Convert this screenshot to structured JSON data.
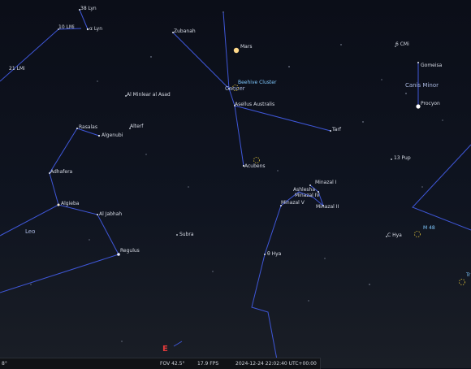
{
  "compass": {
    "east": "E"
  },
  "status": {
    "left_value": "8°",
    "fov": "FOV 42.5°",
    "fps": "17.9 FPS",
    "datetime": "2024-12-24 22:02:40 UTC+00:00"
  },
  "labels": {
    "lyn38": "38 Lyn",
    "lmi10": "10 LMi",
    "alpha_lyn": "α Lyn",
    "lmi21": "21 LMi",
    "zubanah": "Zubanah",
    "mars": "Mars",
    "beehive": "Beehive Cluster",
    "cancer": "Cancer",
    "asellus_australis": "Asellus Australis",
    "minlear": "Al Minlear al Asad",
    "tarf": "Tarf",
    "acubens": "Acubens",
    "rasalas": "Rasalas",
    "alterf": "Alterf",
    "algenubi": "Algenubi",
    "adhafera": "Adhafera",
    "algieba": "Algieba",
    "aljabhah": "Al Jabhah",
    "leo": "Leo",
    "regulus": "Regulus",
    "subra": "Subra",
    "cmi6": "6 CMi",
    "gomeisa": "Gomeisa",
    "canis_minor": "Canis Minor",
    "procyon": "Procyon",
    "pup13": "13 Pup",
    "minazal_i": "Minazal I",
    "ashlesha": "Ashlesha",
    "minazal_iv": "Minazal IV",
    "minazal_v": "Minazal V",
    "minazal_ii": "Minazal II",
    "m48": "M 48",
    "c_hya": "C Hya",
    "theta_hya": "θ Hya",
    "tr": "Tr"
  }
}
